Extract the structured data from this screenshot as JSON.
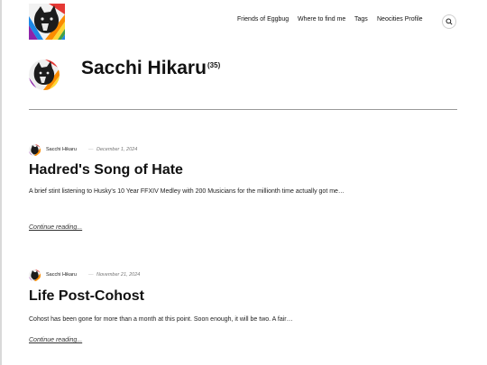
{
  "nav": {
    "items": [
      {
        "label": "Friends of Eggbug"
      },
      {
        "label": "Where to find me"
      },
      {
        "label": "Tags"
      },
      {
        "label": "Neocities Profile"
      }
    ]
  },
  "icons": {
    "search": "search-icon",
    "logo": "cat-pride-avatar"
  },
  "author": {
    "name": "Sacchi Hikaru",
    "count": "(35)"
  },
  "posts": [
    {
      "author": "Sacchi Hikaru",
      "separator": "—",
      "date": "December 1, 2024",
      "title": "Hadred's Song of Hate",
      "excerpt": "A brief stint listening to Husky's 10 Year FFXIV Medley with 200 Musicians for the millionth time actually got me…",
      "continue": "Continue reading..."
    },
    {
      "author": "Sacchi Hikaru",
      "separator": "—",
      "date": "November 21, 2024",
      "title": "Life Post-Cohost",
      "excerpt": "Cohost has been gone for more than a month at this point. Soon enough, it will be two. A fair…",
      "continue": "Continue reading..."
    }
  ],
  "colors": {
    "text": "#111111",
    "divider": "#9a9a9a",
    "date": "#777777"
  }
}
